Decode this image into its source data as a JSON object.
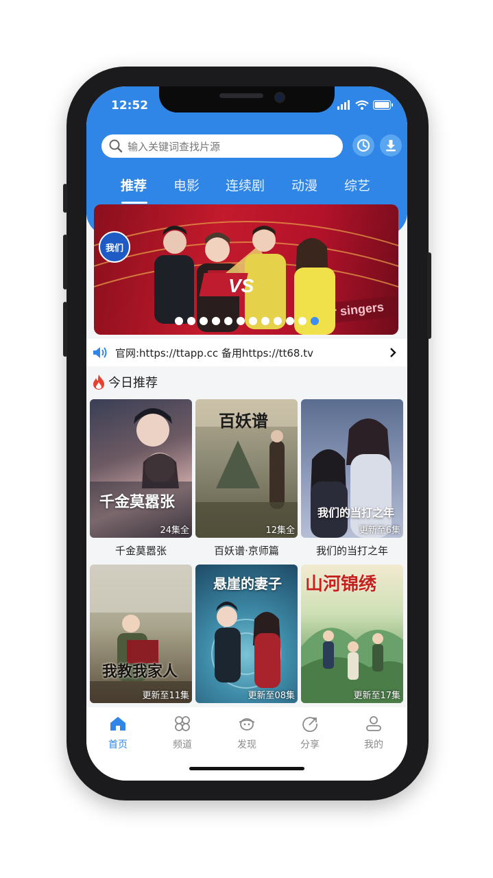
{
  "status_bar": {
    "time": "12:52"
  },
  "search": {
    "placeholder": "输入关键词查找片源",
    "history_icon": "history-icon",
    "download_icon": "download-icon"
  },
  "tabs": [
    {
      "label": "推荐",
      "active": true
    },
    {
      "label": "电影",
      "active": false
    },
    {
      "label": "连续剧",
      "active": false
    },
    {
      "label": "动漫",
      "active": false
    },
    {
      "label": "综艺",
      "active": false
    }
  ],
  "banner": {
    "slide_count": 12,
    "active_slide": 12,
    "overlay_text": "VS",
    "watermark_text": "singer singers"
  },
  "notice": {
    "text": "官网:https://ttapp.cc 备用https://tt68.tv"
  },
  "section": {
    "title": "今日推荐",
    "icon": "fire-icon"
  },
  "items": [
    {
      "title": "千金莫嚣张",
      "badge": "24集全",
      "poster_text": "千金莫嚣张"
    },
    {
      "title": "百妖谱·京师篇",
      "badge": "12集全",
      "poster_text": "百妖谱"
    },
    {
      "title": "我们的当打之年",
      "badge": "更新至6集",
      "poster_text": "我们的当打之年"
    },
    {
      "title": "",
      "badge": "更新至11集",
      "poster_text": "我教我家人"
    },
    {
      "title": "",
      "badge": "更新至08集",
      "poster_text": "悬崖的妻子"
    },
    {
      "title": "",
      "badge": "更新至17集",
      "poster_text": "山河锦绣"
    }
  ],
  "tabbar": [
    {
      "label": "首页",
      "icon": "home-icon",
      "active": true
    },
    {
      "label": "频道",
      "icon": "channel-icon",
      "active": false
    },
    {
      "label": "发现",
      "icon": "discover-icon",
      "active": false
    },
    {
      "label": "分享",
      "icon": "share-icon",
      "active": false
    },
    {
      "label": "我的",
      "icon": "user-icon",
      "active": false
    }
  ],
  "colors": {
    "accent": "#2f86e6",
    "background": "#f4f5f7"
  }
}
